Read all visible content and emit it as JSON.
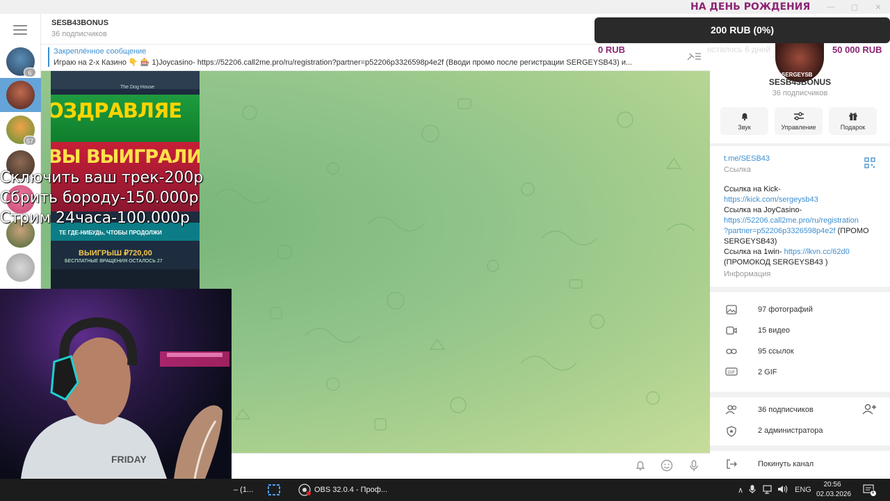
{
  "window": {
    "controls": [
      "—",
      "▢",
      "✕"
    ]
  },
  "folders": {
    "badges": [
      "6",
      "57"
    ]
  },
  "chat": {
    "title": "SESB43BONUS",
    "subtitle": "36 подписчиков",
    "pinned_title": "Закреплённое сообщение",
    "pinned_text": "Играю на 2-х Казино 👇 🎰  1)Joycasino- https://52206.call2me.pro/ru/registration?partner=p52206p3326598p4e2f (Вводи промо после регистрации SERGEYSB43) и..."
  },
  "video": {
    "game_title": "The Dog House",
    "line1": "ОЗДРАВЛЯЕ",
    "line2": "ВЫ ВЫИГРАЛИ",
    "small": "ТЕ ГДЕ-НИБУДЬ, ЧТОБЫ ПРОДОЛЖИ",
    "win": "ВЫИГРЫШ ₽720,00",
    "free": "БЕСПЛАТНЫЕ ВРАЩЕНИЯ ОСТАЛОСЬ 27"
  },
  "overlay": {
    "lines": [
      "Сключить ваш трек-200р",
      "Сбрить бороду-150.000р",
      "Стрим 24часа-100.000р"
    ]
  },
  "stream_goal": {
    "title": "НА ДЕНЬ РОЖДЕНИЯ",
    "current": "200 RUB (0%)",
    "progress_percent": 0,
    "min": "0 RUB",
    "max": "50 000 RUB",
    "days": "осталось 6 дней"
  },
  "info": {
    "avatar_text": "SERGEYSB",
    "name": "SESB43BONUS",
    "subs": "36 подписчиков",
    "actions": [
      {
        "label": "Звук",
        "icon": "bell-icon"
      },
      {
        "label": "Управление",
        "icon": "sliders-icon"
      },
      {
        "label": "Подарок",
        "icon": "gift-icon"
      }
    ],
    "link": "t.me/SESB43",
    "link_caption": "Ссылка",
    "desc_kick_label": "Ссылка на Kick-",
    "desc_kick_url": "https://kick.com/sergeysb43",
    "desc_joy_label": "Ссылка на JoyCasino-",
    "desc_joy_url1": "https://52206.call2me.pro/ru/registration",
    "desc_joy_url2": "?partner=p52206p3326598p4e2f",
    "desc_joy_promo1": " (ПРОМО",
    "desc_joy_promo2": "SERGEYSB43)",
    "desc_1win_label": "Ссылка на 1win- ",
    "desc_1win_url": "https://lkvn.cc/62d0",
    "desc_1win_promo": "(ПРОМОКОД SERGEYSB43 )",
    "desc_caption": "Информация",
    "media": [
      "97 фотографий",
      "15 видео",
      "95 ссылок",
      "2 GIF"
    ],
    "members": "36 подписчиков",
    "admins": "2 администратора",
    "leave": "Покинуть канал"
  },
  "taskbar": {
    "item1": "– (1...",
    "obs": "OBS 32.0.4 - Проф...",
    "lang": "ENG",
    "time": "20:56",
    "date": "02.03.2026",
    "notif_count": "1"
  }
}
